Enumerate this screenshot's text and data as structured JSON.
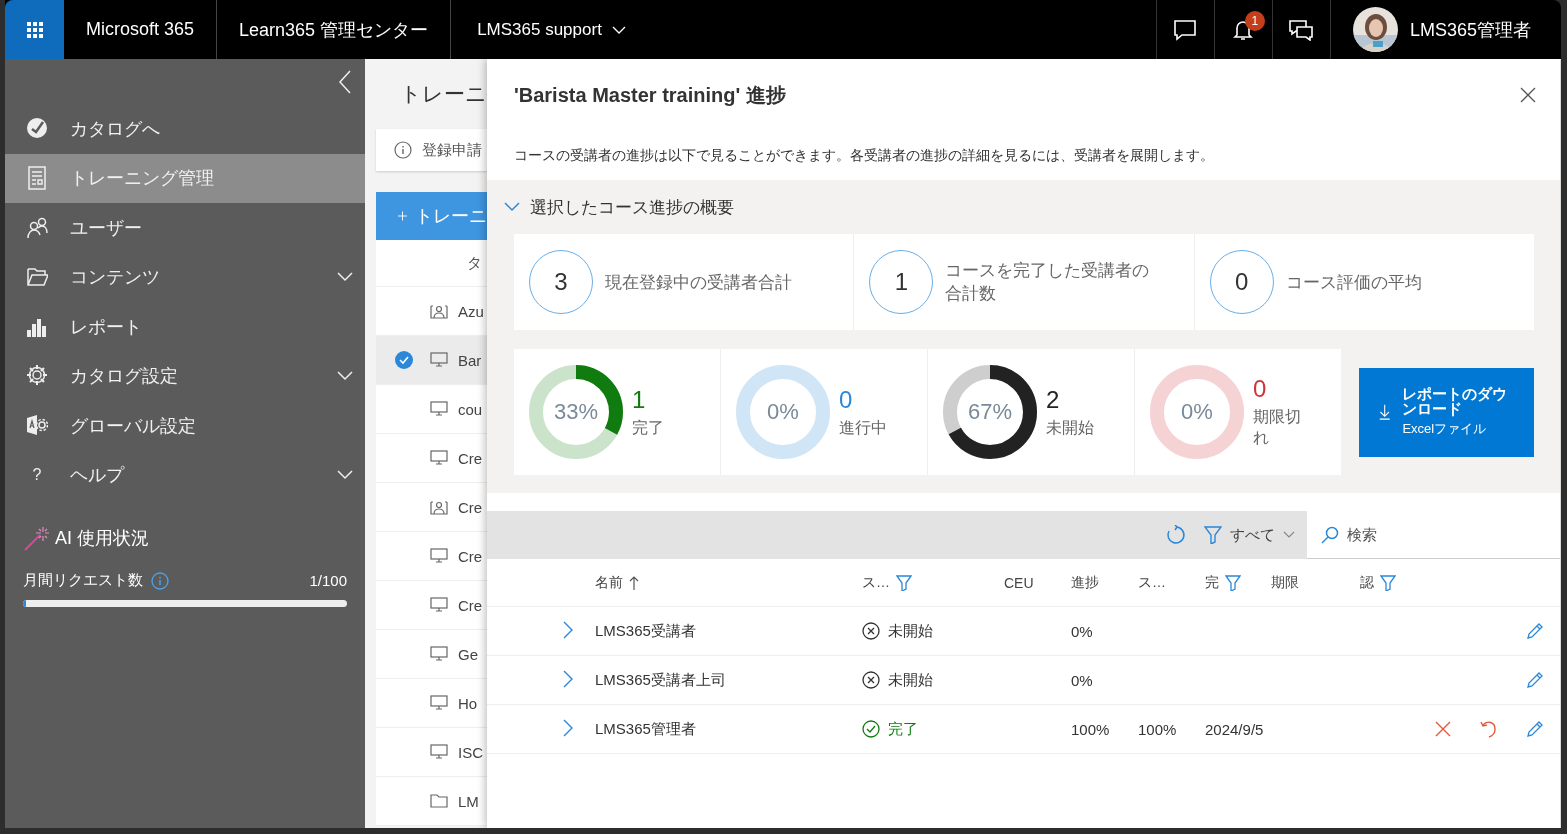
{
  "topbar": {
    "app_name": "Microsoft 365",
    "product": "Learn365 管理センター",
    "tenant": "LMS365 support",
    "notification_count": "1",
    "user_name": "LMS365管理者"
  },
  "sidebar": {
    "items": [
      {
        "kind": "check",
        "label": "カタログへ",
        "selected": false
      },
      {
        "kind": "document",
        "label": "トレーニング管理",
        "selected": true
      },
      {
        "kind": "users",
        "label": "ユーザー",
        "selected": false
      },
      {
        "kind": "folder",
        "label": "コンテンツ",
        "selected": false,
        "expanded": false
      },
      {
        "kind": "chart",
        "label": "レポート",
        "selected": false
      },
      {
        "kind": "gear",
        "label": "カタログ設定",
        "selected": false,
        "expanded": false
      },
      {
        "kind": "global",
        "label": "グローバル設定",
        "selected": false
      },
      {
        "kind": "help",
        "glyph": "?",
        "label": "ヘルプ",
        "selected": false,
        "expanded": false
      }
    ],
    "ai_usage": {
      "title": "AI 使用状況",
      "meter_label": "月間リクエスト数",
      "reading": "1/100",
      "level": 0.01
    }
  },
  "background_page": {
    "title": "トレーニ",
    "banner": "登録申請",
    "add_button": "トレーニ",
    "column_header": "タ",
    "rows": [
      {
        "kind": "classroom",
        "text": "Azu",
        "selected": false
      },
      {
        "kind": "monitor",
        "text": "Bar",
        "selected": true
      },
      {
        "kind": "monitor",
        "text": "cou",
        "selected": false
      },
      {
        "kind": "monitor",
        "text": "Cre",
        "selected": false
      },
      {
        "kind": "classroom",
        "text": "Cre",
        "selected": false
      },
      {
        "kind": "monitor",
        "text": "Cre",
        "selected": false
      },
      {
        "kind": "monitor",
        "text": "Cre",
        "selected": false
      },
      {
        "kind": "monitor",
        "text": "Ge",
        "selected": false
      },
      {
        "kind": "monitor",
        "text": "Ho",
        "selected": false
      },
      {
        "kind": "monitor",
        "text": "ISC",
        "selected": false
      },
      {
        "kind": "folder",
        "text": "LM",
        "selected": false
      }
    ]
  },
  "panel": {
    "title": "'Barista Master training' 進捗",
    "description": "コースの受講者の進捗は以下で見ることができます。各受講者の進捗の詳細を見るには、受講者を展開します。",
    "summary": {
      "title": "選択したコース進捗の概要",
      "expanded": true,
      "stats": [
        {
          "value": "3",
          "label": "現在登録中の受講者合計"
        },
        {
          "value": "1",
          "label": "コースを完了した受講者の合計数"
        },
        {
          "value": "0",
          "label": "コース評価の平均"
        }
      ],
      "donuts": [
        {
          "percent": "33%",
          "level": 0.33,
          "color": "#107c10",
          "count": "1",
          "label": "完了"
        },
        {
          "percent": "0%",
          "level": 0,
          "color": "#2b88d8",
          "count": "0",
          "label": "進行中"
        },
        {
          "percent": "67%",
          "level": 0.67,
          "color": "#222222",
          "count": "2",
          "label": "未開始"
        },
        {
          "percent": "0%",
          "level": 0,
          "color": "#d13438",
          "count": "0",
          "label": "期限切れ"
        }
      ],
      "download": {
        "title": "レポートのダウンロード",
        "subtitle": "Excelファイル"
      }
    },
    "toolbar": {
      "filter": "すべて",
      "search_placeholder": "検索"
    },
    "table": {
      "columns": [
        {
          "label": "名前",
          "sorted_ascending": true,
          "filter": false
        },
        {
          "label": "ス…",
          "filter": true
        },
        {
          "label": "CEU",
          "filter": false
        },
        {
          "label": "進捗",
          "filter": false
        },
        {
          "label": "ス…",
          "filter": false
        },
        {
          "label": "完",
          "filter": true
        },
        {
          "label": "期限",
          "filter": false
        },
        {
          "label": "認",
          "filter": true
        }
      ],
      "rows": [
        {
          "expanded": false,
          "name": "LMS365受講者",
          "kind": "not_started",
          "status": "未開始",
          "progress": "0%",
          "can_delete": false,
          "can_reset": false,
          "can_edit": true
        },
        {
          "expanded": false,
          "name": "LMS365受講者上司",
          "kind": "not_started",
          "status": "未開始",
          "progress": "0%",
          "can_delete": false,
          "can_reset": false,
          "can_edit": true
        },
        {
          "expanded": false,
          "name": "LMS365管理者",
          "kind": "completed",
          "status": "完了",
          "progress": "100%",
          "score": "100%",
          "completed": "2024/9/5",
          "can_delete": true,
          "can_reset": true,
          "can_edit": true
        }
      ]
    }
  }
}
